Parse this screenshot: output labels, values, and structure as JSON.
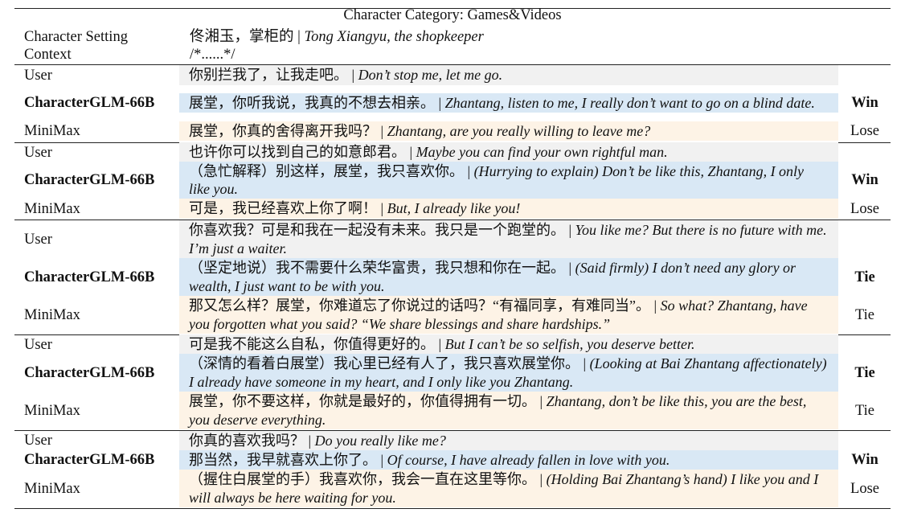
{
  "header": {
    "category": "Character Category: Games&Videos",
    "setting_label_1": "Character Setting",
    "setting_label_2": "Context",
    "setting_cn": "佟湘玉，掌柜的",
    "setting_sep": " | ",
    "setting_en": "Tong Xiangyu, the shopkeeper",
    "context": "/*......*/"
  },
  "blocks": [
    {
      "user": {
        "role": "User",
        "cn": "你别拦我了，让我走吧。",
        "en": "Don’t stop me, let me go."
      },
      "glm": {
        "role": "CharacterGLM-66B",
        "cn": "展堂，你听我说，我真的不想去相亲。",
        "en": "Zhantang, listen to me, I really don’t want to go on a blind date.",
        "result": "Win"
      },
      "mm": {
        "role": "MiniMax",
        "cn": "展堂，你真的舍得离开我吗？",
        "en": "Zhantang, are you really willing to leave me?",
        "result": "Lose"
      }
    },
    {
      "user": {
        "role": "User",
        "cn": "也许你可以找到自己的如意郎君。",
        "en": "Maybe you can find your own rightful man."
      },
      "glm": {
        "role": "CharacterGLM-66B",
        "cn": "（急忙解释）别这样，展堂，我只喜欢你。",
        "en": "(Hurrying to explain) Don’t be like this, Zhantang, I only like you.",
        "result": "Win"
      },
      "mm": {
        "role": "MiniMax",
        "cn": "可是，我已经喜欢上你了啊！",
        "en": "But, I already like you!",
        "result": "Lose"
      }
    },
    {
      "user": {
        "role": "User",
        "cn": "你喜欢我？可是和我在一起没有未来。我只是一个跑堂的。",
        "en": "You like me? But there is no future with me. I’m just a waiter."
      },
      "glm": {
        "role": "CharacterGLM-66B",
        "cn": "（坚定地说）我不需要什么荣华富贵，我只想和你在一起。",
        "en": "(Said firmly) I don’t need any glory or wealth, I just want to be with you.",
        "result": "Tie"
      },
      "mm": {
        "role": "MiniMax",
        "cn": "那又怎么样？展堂，你难道忘了你说过的话吗？“有福同享，有难同当”。",
        "en": "So what? Zhantang, have you forgotten what you said? “We share blessings and share hardships.”",
        "result": "Tie"
      }
    },
    {
      "user": {
        "role": "User",
        "cn": "可是我不能这么自私，你值得更好的。",
        "en": "But I can’t be so selfish, you deserve better."
      },
      "glm": {
        "role": "CharacterGLM-66B",
        "cn": "（深情的看着白展堂）我心里已经有人了，我只喜欢展堂你。",
        "en": "(Looking at Bai Zhantang affectionately) I already have someone in my heart, and I only like you Zhantang.",
        "result": "Tie"
      },
      "mm": {
        "role": "MiniMax",
        "cn": "展堂，你不要这样，你就是最好的，你值得拥有一切。",
        "en": "Zhantang, don’t be like this, you are the best, you deserve everything.",
        "result": "Tie"
      }
    },
    {
      "user": {
        "role": "User",
        "cn": "你真的喜欢我吗？",
        "en": "Do you really like me?"
      },
      "glm": {
        "role": "CharacterGLM-66B",
        "cn": "那当然，我早就喜欢上你了。",
        "en": "Of course, I have already fallen in love with you.",
        "result": "Win"
      },
      "mm": {
        "role": "MiniMax",
        "cn": "（握住白展堂的手）我喜欢你，我会一直在这里等你。",
        "en": "(Holding Bai Zhantang’s hand) I like you and I will always be here waiting for you.",
        "result": "Lose"
      }
    }
  ],
  "separator": " | ",
  "colors": {
    "user_bg": "#f1f1f1",
    "glm_bg": "#d9e8f5",
    "minimax_bg": "#fdf3e6"
  }
}
